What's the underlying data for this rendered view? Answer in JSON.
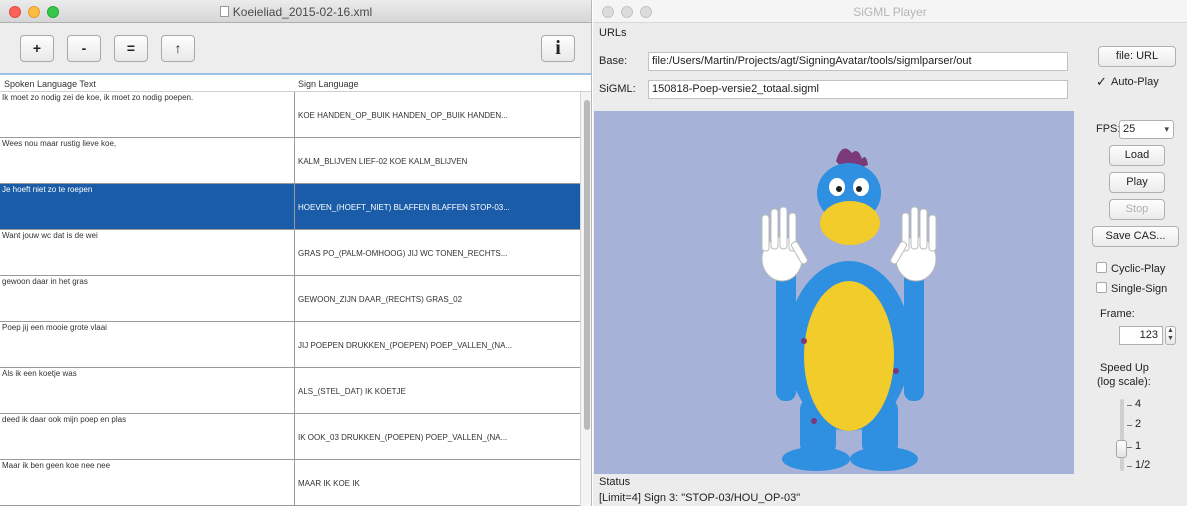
{
  "left_window": {
    "title": "Koeieliad_2015-02-16.xml",
    "toolbar": {
      "add_label": "+",
      "remove_label": "-",
      "equal_label": "=",
      "up_label": "↑",
      "info_label": "i"
    },
    "columns": [
      "Spoken Language Text",
      "Sign Language"
    ],
    "rows": [
      {
        "spoken": "Ik moet zo nodig zei de koe, ik moet zo nodig poepen.",
        "sign": "KOE HANDEN_OP_BUIK HANDEN_OP_BUIK HANDEN..."
      },
      {
        "spoken": "Wees nou maar rustig lieve koe,",
        "sign": "KALM_BLIJVEN LIEF-02 KOE KALM_BLIJVEN"
      },
      {
        "spoken": "Je hoeft niet zo te roepen",
        "sign": "HOEVEN_(HOEFT_NIET) BLAFFEN BLAFFEN STOP-03..."
      },
      {
        "spoken": "Want jouw wc dat is de wei",
        "sign": "GRAS PO_(PALM-OMHOOG) JIJ WC TONEN_RECHTS..."
      },
      {
        "spoken": "gewoon daar in het gras",
        "sign": "GEWOON_ZIJN DAAR_(RECHTS) GRAS_02"
      },
      {
        "spoken": "Poep jij een mooie grote vlaai",
        "sign": "JIJ POEPEN DRUKKEN_(POEPEN) POEP_VALLEN_(NA..."
      },
      {
        "spoken": "Als ik een koetje was",
        "sign": "ALS_(STEL_DAT) IK KOETJE"
      },
      {
        "spoken": "deed ik daar ook mijn poep en plas",
        "sign": "IK OOK_03 DRUKKEN_(POEPEN) POEP_VALLEN_(NA..."
      },
      {
        "spoken": "Maar ik ben geen koe nee nee",
        "sign": "MAAR IK KOE IK"
      }
    ],
    "selected_row": 2
  },
  "right_window": {
    "title": "SiGML Player",
    "urls_label": "URLs",
    "base_label": "Base:",
    "base_value": "file:/Users/Martin/Projects/agt/SigningAvatar/tools/sigmlparser/out",
    "sigml_label": "SiGML:",
    "sigml_value": "150818-Poep-versie2_totaal.sigml",
    "file_url_label": "file: URL",
    "auto_play_label": "Auto-Play",
    "auto_play_checked": true,
    "fps_label": "FPS:",
    "fps_value": "25",
    "load_label": "Load",
    "play_label": "Play",
    "stop_label": "Stop",
    "save_cas_label": "Save CAS...",
    "cyclic_play_label": "Cyclic-Play",
    "single_sign_label": "Single-Sign",
    "frame_label": "Frame:",
    "frame_value": "123",
    "speed_label_1": "Speed Up",
    "speed_label_2": "(log scale):",
    "speed_ticks": [
      "4",
      "2",
      "1",
      "1/2"
    ],
    "speed_value": "1",
    "status_label": "Status",
    "status_text": "[Limit=4]  Sign 3:  \"STOP-03/HOU_OP-03\""
  },
  "colors": {
    "selection": "#1a5ca8",
    "viewport_bg": "#a6b2d8",
    "avatar_blue": "#2f8fe0",
    "avatar_yellow": "#f2cc2a"
  }
}
